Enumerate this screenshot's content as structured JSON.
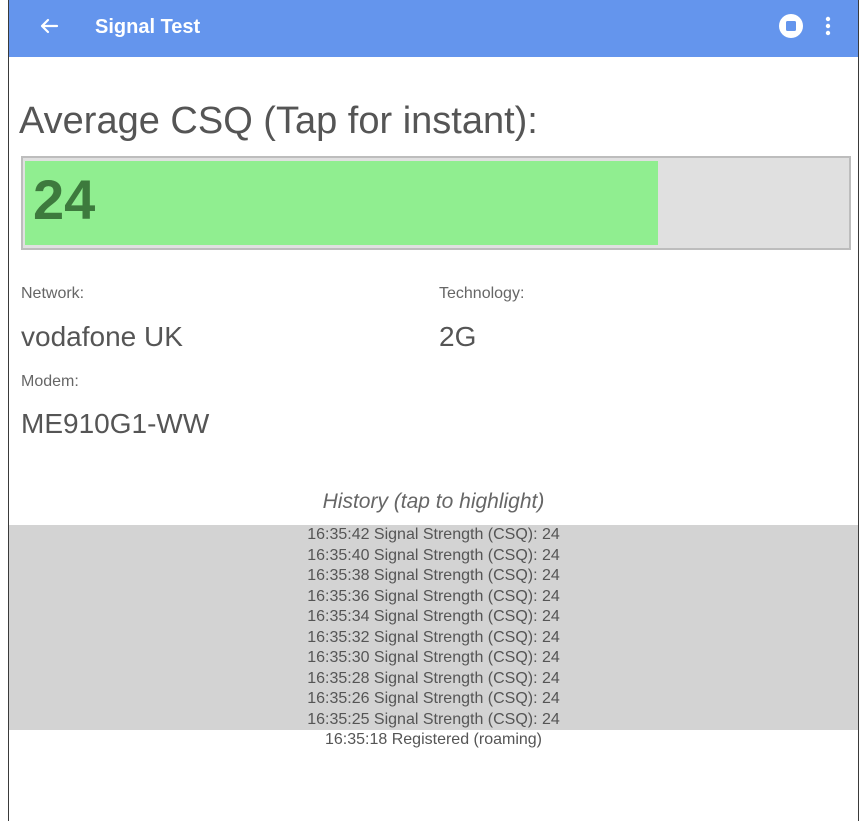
{
  "app_bar": {
    "title": "Signal Test",
    "back_icon": "arrow-left-icon",
    "stop_icon": "stop-circle-icon",
    "menu_icon": "more-vert-icon",
    "background_color": "#6495ed"
  },
  "signal": {
    "label": "Average CSQ (Tap for instant):",
    "value": "24",
    "level_fraction": 0.77,
    "fill_color": "#90ee90",
    "track_color": "#e0e0e0"
  },
  "network": {
    "label": "Network:",
    "value": "vodafone UK"
  },
  "technology": {
    "label": "Technology:",
    "value": "2G"
  },
  "modem": {
    "label": "Modem:",
    "value": "ME910G1-WW"
  },
  "history": {
    "title": "History (tap to highlight)",
    "highlight_color": "#d3d3d3",
    "items": [
      {
        "text": "16:35:42 Signal Strength (CSQ): 24",
        "highlighted": true
      },
      {
        "text": "16:35:40 Signal Strength (CSQ): 24",
        "highlighted": true
      },
      {
        "text": "16:35:38 Signal Strength (CSQ): 24",
        "highlighted": true
      },
      {
        "text": "16:35:36 Signal Strength (CSQ): 24",
        "highlighted": true
      },
      {
        "text": "16:35:34 Signal Strength (CSQ): 24",
        "highlighted": true
      },
      {
        "text": "16:35:32 Signal Strength (CSQ): 24",
        "highlighted": true
      },
      {
        "text": "16:35:30 Signal Strength (CSQ): 24",
        "highlighted": true
      },
      {
        "text": "16:35:28 Signal Strength (CSQ): 24",
        "highlighted": true
      },
      {
        "text": "16:35:26 Signal Strength (CSQ): 24",
        "highlighted": true
      },
      {
        "text": "16:35:25 Signal Strength (CSQ): 24",
        "highlighted": true
      },
      {
        "text": "16:35:18 Registered (roaming)",
        "highlighted": false
      }
    ]
  }
}
